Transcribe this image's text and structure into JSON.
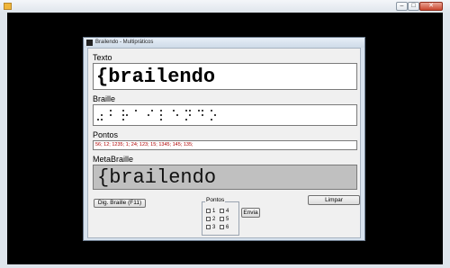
{
  "outer_window": {
    "title": "",
    "controls": {
      "minimize": "–",
      "maximize": "□",
      "close": "✕"
    }
  },
  "window": {
    "title": "Brailendo - Multipráticos",
    "icon": "braille-app-icon"
  },
  "texto": {
    "label": "Texto",
    "value": "{brailendo"
  },
  "braille": {
    "label": "Braille",
    "cells": [
      [
        3,
        5,
        6
      ],
      [
        1,
        2
      ],
      [
        1,
        2,
        3,
        5
      ],
      [
        1
      ],
      [
        2,
        4
      ],
      [
        1,
        2,
        3
      ],
      [
        1,
        5
      ],
      [
        1,
        3,
        4,
        5
      ],
      [
        1,
        4,
        5
      ],
      [
        1,
        3,
        5
      ]
    ]
  },
  "pontos": {
    "label": "Pontos",
    "value": "56; 12; 1235; 1; 24; 123; 15; 1345; 145; 135;"
  },
  "metabraille": {
    "label": "MetaBraille",
    "value": "{brailendo"
  },
  "buttons": {
    "dig_braille": "Dig. Braille (F11)",
    "limpar": "Limpar",
    "envia": "Envia"
  },
  "pontos_group": {
    "label": "Pontos",
    "checkboxes": [
      "1",
      "4",
      "2",
      "5",
      "3",
      "6"
    ]
  },
  "colors": {
    "pontos_text": "#b00000",
    "metabraille_bg": "#c0c0c0",
    "desktop_bg": "#000000"
  }
}
